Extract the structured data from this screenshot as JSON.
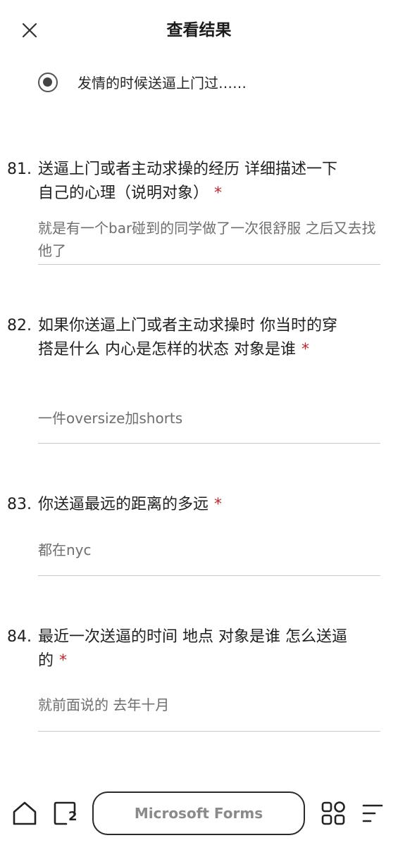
{
  "header": {
    "title": "查看结果",
    "close_icon": "close-icon"
  },
  "prev_answer": {
    "option_label": "发情的时候送逼上门过……",
    "selected": true
  },
  "questions": [
    {
      "number": "81.",
      "text": "送逼上门或者主动求操的经历 详细描述一下自己的心理（说明对象）",
      "required_mark": "*",
      "answer": "就是有一个bar碰到的同学做了一次很舒服 之后又去找他了"
    },
    {
      "number": "82.",
      "text": "如果你送逼上门或者主动求操时 你当时的穿搭是什么 内心是怎样的状态 对象是谁",
      "required_mark": "*",
      "answer": "一件oversize加shorts"
    },
    {
      "number": "83.",
      "text": "你送逼最远的距离的多远",
      "required_mark": "*",
      "answer": "都在nyc"
    },
    {
      "number": "84.",
      "text": "最近一次送逼的时间 地点 对象是谁 怎么送逼的",
      "required_mark": "*",
      "answer": "就前面说的 去年十月"
    }
  ],
  "bottom_bar": {
    "home_icon": "home-icon",
    "tabs_icon": "tabs-icon",
    "tab_count": "2",
    "address_text": "Microsoft Forms",
    "apps_icon": "apps-grid-icon",
    "menu_icon": "menu-icon"
  },
  "colors": {
    "required": "#c4262e",
    "answer_text": "#6e6e6e",
    "underline": "#c8c8c8"
  }
}
